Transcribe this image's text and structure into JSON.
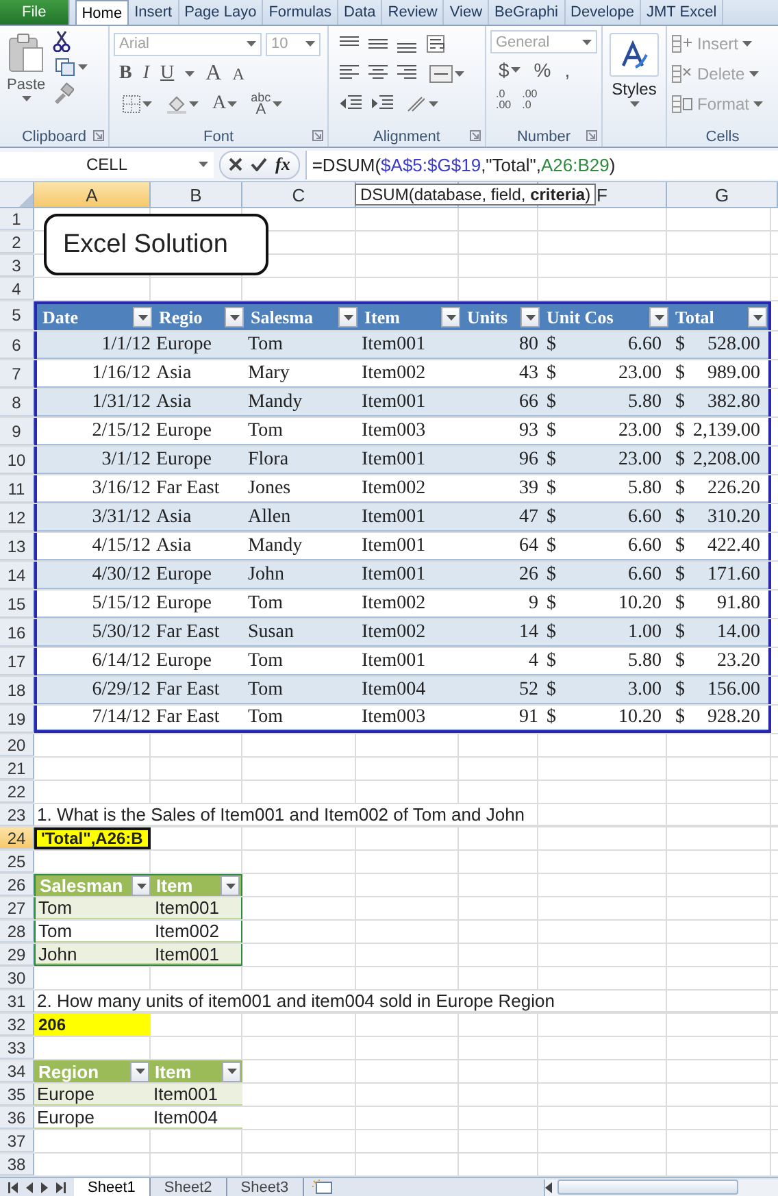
{
  "ribbon_tabs": [
    {
      "label": "File",
      "kind": "file",
      "selected": false
    },
    {
      "label": "Home",
      "kind": "tab",
      "selected": true
    },
    {
      "label": "Insert",
      "kind": "tab",
      "selected": false
    },
    {
      "label": "Page Layo",
      "kind": "tab",
      "selected": false
    },
    {
      "label": "Formulas",
      "kind": "tab",
      "selected": false
    },
    {
      "label": "Data",
      "kind": "tab",
      "selected": false
    },
    {
      "label": "Review",
      "kind": "tab",
      "selected": false
    },
    {
      "label": "View",
      "kind": "tab",
      "selected": false
    },
    {
      "label": "BeGraphi",
      "kind": "tab",
      "selected": false
    },
    {
      "label": "Develope",
      "kind": "tab",
      "selected": false
    },
    {
      "label": "JMT Excel",
      "kind": "tab",
      "selected": false
    }
  ],
  "ribbon": {
    "clipboard": {
      "label": "Clipboard",
      "paste": "Paste"
    },
    "font": {
      "label": "Font",
      "name": {
        "value": "Arial",
        "disabled": true
      },
      "size": {
        "value": "10",
        "disabled": true
      },
      "style_buttons": [
        "B",
        "I",
        "U"
      ],
      "size_buttons": [
        "A",
        "A"
      ],
      "color_button": "A",
      "phonetic_button": {
        "top": "abc",
        "bottom": "A"
      }
    },
    "alignment": {
      "label": "Alignment"
    },
    "number": {
      "label": "Number",
      "format": {
        "value": "General",
        "disabled": true
      },
      "symbols": [
        "$",
        "%",
        ","
      ],
      "decimal_buttons": [
        {
          "top": ".0",
          "bottom": ".00"
        },
        {
          "top": ".00",
          "bottom": ".0"
        }
      ]
    },
    "styles": {
      "label": "Styles"
    },
    "cells": {
      "label": "Cells",
      "buttons": [
        {
          "label": "Insert",
          "kind": "insert",
          "disabled": true
        },
        {
          "label": "Delete",
          "kind": "delete",
          "disabled": true
        },
        {
          "label": "Format",
          "kind": "format",
          "disabled": true
        }
      ]
    }
  },
  "formula_bar": {
    "name_box": "CELL",
    "function_button": "fx",
    "formula": [
      {
        "text": "=DSUM("
      },
      {
        "text": "$A$5:$G$19",
        "color": "#3c3cc8"
      },
      {
        "text": ",\"Total\","
      },
      {
        "text": "A26:B29",
        "color": "#2e8b3e"
      },
      {
        "text": ")"
      }
    ],
    "tooltip": "DSUM(database, field, **criteria**)"
  },
  "sheet": {
    "column_headers": [
      {
        "label": "A",
        "selected": true
      },
      {
        "label": "B",
        "selected": false
      },
      {
        "label": "C",
        "selected": false
      },
      {
        "selected": false
      },
      {
        "selected": false
      },
      {
        "label": "F",
        "selected": false
      },
      {
        "label": "G",
        "selected": false
      }
    ],
    "title_box": "Excel Solution",
    "rows": [
      {
        "header": "1",
        "selected": false,
        "kind": "blank"
      },
      {
        "header": "2",
        "selected": false,
        "kind": "blank"
      },
      {
        "header": "3",
        "selected": false,
        "kind": "blank"
      },
      {
        "header": "4",
        "selected": false,
        "kind": "blank"
      },
      {
        "header": "5",
        "selected": false,
        "kind": "table_header",
        "highlighted": true,
        "cells": [
          "Date",
          "Regio",
          "Salesma",
          "Item",
          "Units",
          "Unit Cos",
          "Total"
        ]
      },
      {
        "header": "6",
        "selected": false,
        "kind": "table_row",
        "highlighted": true,
        "cells": [
          "1/1/12",
          "Europe",
          "Tom",
          "Item001",
          "80",
          "$",
          "6.60",
          "$",
          "528.00"
        ]
      },
      {
        "header": "7",
        "selected": false,
        "kind": "table_row",
        "highlighted": true,
        "cells": [
          "1/16/12",
          "Asia",
          "Mary",
          "Item002",
          "43",
          "$",
          "23.00",
          "$",
          "989.00"
        ]
      },
      {
        "header": "8",
        "selected": false,
        "kind": "table_row",
        "highlighted": true,
        "cells": [
          "1/31/12",
          "Asia",
          "Mandy",
          "Item001",
          "66",
          "$",
          "5.80",
          "$",
          "382.80"
        ]
      },
      {
        "header": "9",
        "selected": false,
        "kind": "table_row",
        "highlighted": true,
        "cells": [
          "2/15/12",
          "Europe",
          "Tom",
          "Item003",
          "93",
          "$",
          "23.00",
          "$",
          "2,139.00"
        ]
      },
      {
        "header": "10",
        "selected": false,
        "kind": "table_row",
        "highlighted": true,
        "cells": [
          "3/1/12",
          "Europe",
          "Flora",
          "Item001",
          "96",
          "$",
          "23.00",
          "$",
          "2,208.00"
        ]
      },
      {
        "header": "11",
        "selected": false,
        "kind": "table_row",
        "highlighted": true,
        "cells": [
          "3/16/12",
          "Far East",
          "Jones",
          "Item002",
          "39",
          "$",
          "5.80",
          "$",
          "226.20"
        ]
      },
      {
        "header": "12",
        "selected": false,
        "kind": "table_row",
        "highlighted": true,
        "cells": [
          "3/31/12",
          "Asia",
          "Allen",
          "Item001",
          "47",
          "$",
          "6.60",
          "$",
          "310.20"
        ]
      },
      {
        "header": "13",
        "selected": false,
        "kind": "table_row",
        "highlighted": true,
        "cells": [
          "4/15/12",
          "Asia",
          "Mandy",
          "Item001",
          "64",
          "$",
          "6.60",
          "$",
          "422.40"
        ]
      },
      {
        "header": "14",
        "selected": false,
        "kind": "table_row",
        "highlighted": true,
        "cells": [
          "4/30/12",
          "Europe",
          "John",
          "Item001",
          "26",
          "$",
          "6.60",
          "$",
          "171.60"
        ]
      },
      {
        "header": "15",
        "selected": false,
        "kind": "table_row",
        "highlighted": true,
        "cells": [
          "5/15/12",
          "Europe",
          "Tom",
          "Item002",
          "9",
          "$",
          "10.20",
          "$",
          "91.80"
        ]
      },
      {
        "header": "16",
        "selected": false,
        "kind": "table_row",
        "highlighted": true,
        "cells": [
          "5/30/12",
          "Far East",
          "Susan",
          "Item002",
          "14",
          "$",
          "1.00",
          "$",
          "14.00"
        ]
      },
      {
        "header": "17",
        "selected": false,
        "kind": "table_row",
        "highlighted": true,
        "cells": [
          "6/14/12",
          "Europe",
          "Tom",
          "Item001",
          "4",
          "$",
          "5.80",
          "$",
          "23.20"
        ]
      },
      {
        "header": "18",
        "selected": false,
        "kind": "table_row",
        "highlighted": true,
        "cells": [
          "6/29/12",
          "Far East",
          "Tom",
          "Item004",
          "52",
          "$",
          "3.00",
          "$",
          "156.00"
        ]
      },
      {
        "header": "19",
        "selected": false,
        "kind": "table_row",
        "highlighted": true,
        "cells": [
          "7/14/12",
          "Far East",
          "Tom",
          "Item003",
          "91",
          "$",
          "10.20",
          "$",
          "928.20"
        ]
      },
      {
        "header": "20",
        "selected": false,
        "kind": "blank"
      },
      {
        "header": "21",
        "selected": false,
        "kind": "blank"
      },
      {
        "header": "22",
        "selected": false,
        "kind": "blank"
      },
      {
        "header": "23",
        "selected": false,
        "kind": "text",
        "text": "1. What is the Sales of Item001 and Item002 of Tom and John"
      },
      {
        "header": "24",
        "selected": true,
        "kind": "answer",
        "active": true,
        "text": "'Total\",A26:B"
      },
      {
        "header": "25",
        "selected": false,
        "kind": "blank"
      },
      {
        "header": "26",
        "selected": false,
        "kind": "criteria_header",
        "highlighted": true,
        "cells": [
          "Salesman",
          "Item"
        ]
      },
      {
        "header": "27",
        "selected": false,
        "kind": "criteria_row",
        "highlighted": true,
        "cells": [
          "Tom",
          "Item001"
        ]
      },
      {
        "header": "28",
        "selected": false,
        "kind": "criteria_row",
        "highlighted": true,
        "cells": [
          "Tom",
          "Item002"
        ]
      },
      {
        "header": "29",
        "selected": false,
        "kind": "criteria_row",
        "highlighted": true,
        "cells": [
          "John",
          "Item001"
        ]
      },
      {
        "header": "30",
        "selected": false,
        "kind": "blank"
      },
      {
        "header": "31",
        "selected": false,
        "kind": "text",
        "text": "2. How many units of item001 and item004 sold in Europe Region"
      },
      {
        "header": "32",
        "selected": false,
        "kind": "answer",
        "active": false,
        "text": "206"
      },
      {
        "header": "33",
        "selected": false,
        "kind": "blank"
      },
      {
        "header": "34",
        "selected": false,
        "kind": "criteria_header",
        "highlighted": false,
        "cells": [
          "Region",
          "Item"
        ]
      },
      {
        "header": "35",
        "selected": false,
        "kind": "criteria_row",
        "highlighted": false,
        "cells": [
          "Europe",
          "Item001"
        ]
      },
      {
        "header": "36",
        "selected": false,
        "kind": "criteria_row",
        "highlighted": false,
        "cells": [
          "Europe",
          "Item004"
        ]
      },
      {
        "header": "37",
        "selected": false,
        "kind": "blank"
      },
      {
        "header": "38",
        "selected": false,
        "kind": "blank"
      }
    ]
  },
  "sheet_tabs": [
    {
      "label": "Sheet1",
      "selected": true
    },
    {
      "label": "Sheet2",
      "selected": false
    },
    {
      "label": "Sheet3",
      "selected": false
    }
  ]
}
